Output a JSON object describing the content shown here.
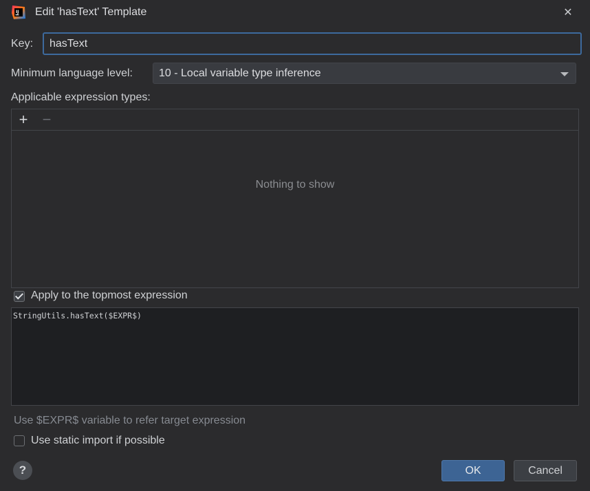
{
  "window": {
    "title": "Edit 'hasText' Template",
    "close_icon": "close-icon",
    "app_icon": "intellij-idea-icon"
  },
  "form": {
    "key_label": "Key:",
    "key_value": "hasText",
    "min_level_label": "Minimum language level:",
    "min_level_value": "10 - Local variable type inference",
    "applicable_label": "Applicable expression types:",
    "add_icon": "plus-icon",
    "remove_icon": "minus-icon",
    "empty_text": "Nothing to show",
    "topmost_label": "Apply to the topmost expression",
    "topmost_checked": true,
    "template_text": "StringUtils.hasText($EXPR$)",
    "hint": "Use $EXPR$ variable to refer target expression",
    "static_import_label": "Use static import if possible",
    "static_import_checked": false
  },
  "footer": {
    "help_label": "?",
    "ok_label": "OK",
    "cancel_label": "Cancel"
  },
  "colors": {
    "background": "#2b2b2d",
    "focus_border": "#3d6a9e",
    "primary_button": "#3d6494",
    "editor_bg": "#1e1f22"
  }
}
